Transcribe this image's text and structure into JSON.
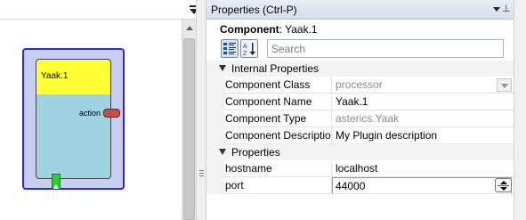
{
  "designer": {
    "component_label": "Yaak.1",
    "port_label": "action"
  },
  "properties_panel": {
    "title": "Properties (Ctrl-P)",
    "component_prefix": "Component",
    "component_name": ": Yaak.1",
    "search_placeholder": "Search",
    "sections": {
      "internal": "Internal Properties",
      "properties": "Properties"
    },
    "internal_rows": [
      {
        "name": "Component Class",
        "value": "processor"
      },
      {
        "name": "Component Name",
        "value": "Yaak.1"
      },
      {
        "name": "Component Type",
        "value": "asterics.Yaak"
      },
      {
        "name": "Component Description",
        "value": "My Plugin description"
      }
    ],
    "property_rows": [
      {
        "name": "hostname",
        "value": "localhost"
      },
      {
        "name": "port",
        "value": "44000"
      }
    ]
  },
  "colors": {
    "component_header": "#ffff33",
    "component_body": "#9fd3e0",
    "component_frame": "#2a28d0",
    "port_knob": "#c05050",
    "event_trigger": "#33cc33"
  },
  "icons": [
    "dropdown-icon",
    "pin-icon",
    "categorized-icon",
    "sort-az-icon",
    "event-trigger-icon",
    "spinner-icon",
    "combo-arrow-icon",
    "grip-icon"
  ]
}
